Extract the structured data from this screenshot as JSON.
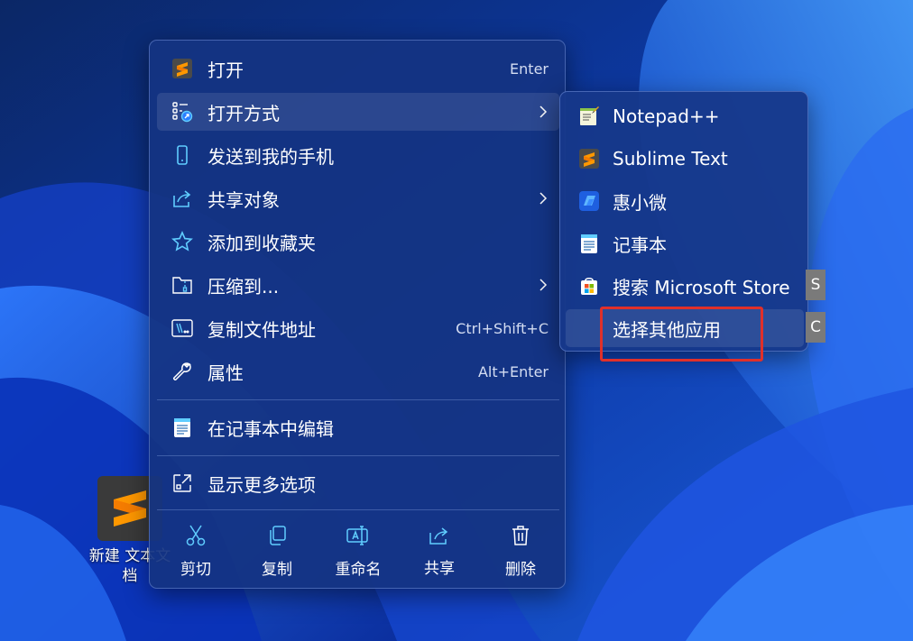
{
  "desktop": {
    "file_label": "新建 文本文\n档"
  },
  "context_menu": {
    "items": [
      {
        "label": "打开",
        "shortcut": "Enter"
      },
      {
        "label": "打开方式"
      },
      {
        "label": "发送到我的手机"
      },
      {
        "label": "共享对象"
      },
      {
        "label": "添加到收藏夹"
      },
      {
        "label": "压缩到..."
      },
      {
        "label": "复制文件地址",
        "shortcut": "Ctrl+Shift+C"
      },
      {
        "label": "属性",
        "shortcut": "Alt+Enter"
      },
      {
        "label": "在记事本中编辑"
      },
      {
        "label": "显示更多选项"
      }
    ],
    "actions": [
      {
        "label": "剪切",
        "icon": "scissors-icon"
      },
      {
        "label": "复制",
        "icon": "copy-icon"
      },
      {
        "label": "重命名",
        "icon": "rename-icon"
      },
      {
        "label": "共享",
        "icon": "share-icon"
      },
      {
        "label": "删除",
        "icon": "trash-icon"
      }
    ]
  },
  "open_with_submenu": {
    "items": [
      {
        "label": "Notepad++"
      },
      {
        "label": "Sublime Text"
      },
      {
        "label": "惠小微"
      },
      {
        "label": "记事本"
      },
      {
        "label": "搜索 Microsoft Store",
        "access_key": "S"
      },
      {
        "label": "选择其他应用",
        "access_key": "C"
      }
    ]
  },
  "colors": {
    "menu_bg": "#14348a",
    "accent_icon": "#60cdff",
    "highlight_box": "#e0302a",
    "sublime_orange": "#ff9800"
  }
}
